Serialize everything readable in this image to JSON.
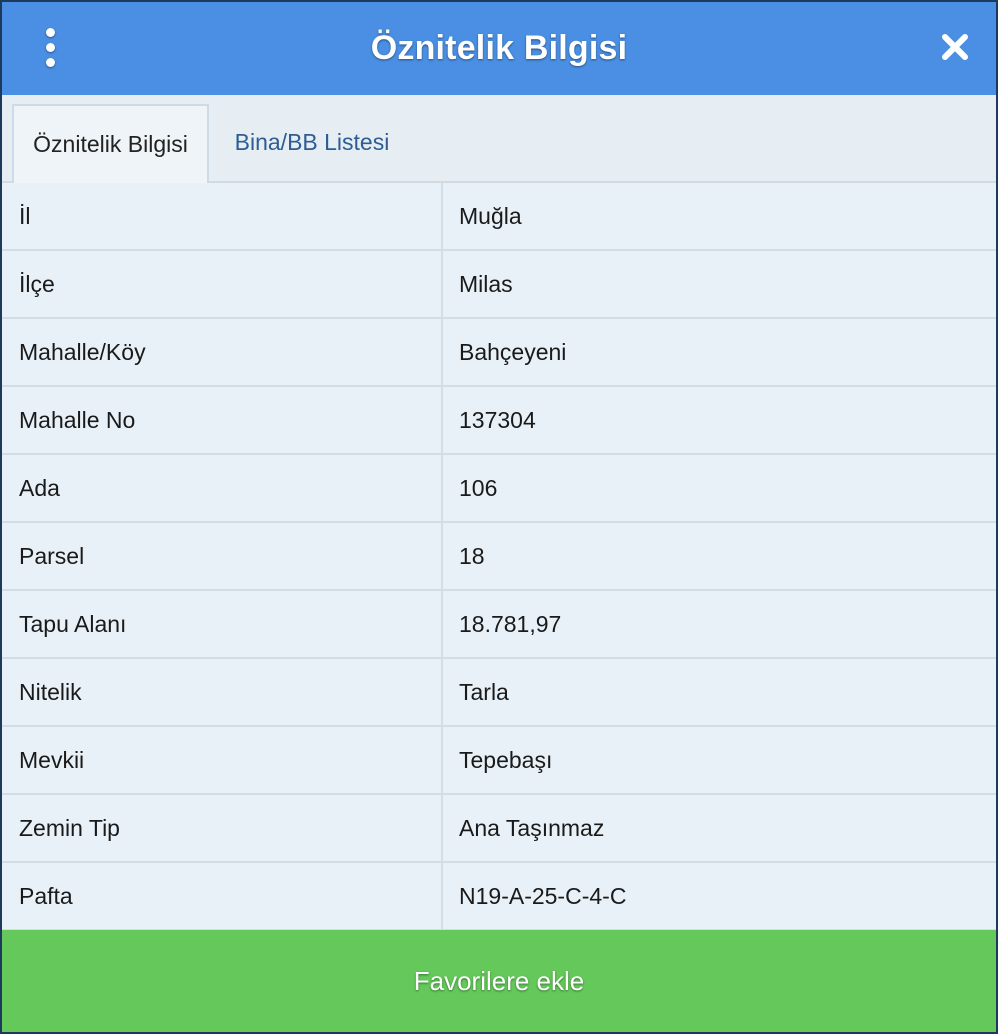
{
  "header": {
    "title": "Öznitelik Bilgisi",
    "menu_icon": "kebab-menu-icon",
    "close_icon": "close-icon"
  },
  "tabs": [
    {
      "label": "Öznitelik Bilgisi",
      "active": true
    },
    {
      "label": "Bina/BB Listesi",
      "active": false
    }
  ],
  "rows": [
    {
      "key": "İl",
      "value": "Muğla"
    },
    {
      "key": "İlçe",
      "value": "Milas"
    },
    {
      "key": "Mahalle/Köy",
      "value": "Bahçeyeni"
    },
    {
      "key": "Mahalle No",
      "value": "137304"
    },
    {
      "key": "Ada",
      "value": "106"
    },
    {
      "key": "Parsel",
      "value": "18"
    },
    {
      "key": "Tapu Alanı",
      "value": "18.781,97"
    },
    {
      "key": "Nitelik",
      "value": "Tarla"
    },
    {
      "key": "Mevkii",
      "value": "Tepebaşı"
    },
    {
      "key": "Zemin Tip",
      "value": "Ana Taşınmaz"
    },
    {
      "key": "Pafta",
      "value": "N19-A-25-C-4-C"
    }
  ],
  "footer": {
    "button_label": "Favorilere ekle"
  },
  "colors": {
    "header_bg": "#4a8fe3",
    "footer_bg": "#64c95a",
    "row_bg": "#e8f1f7",
    "tab_inactive_text": "#2e5d92"
  }
}
